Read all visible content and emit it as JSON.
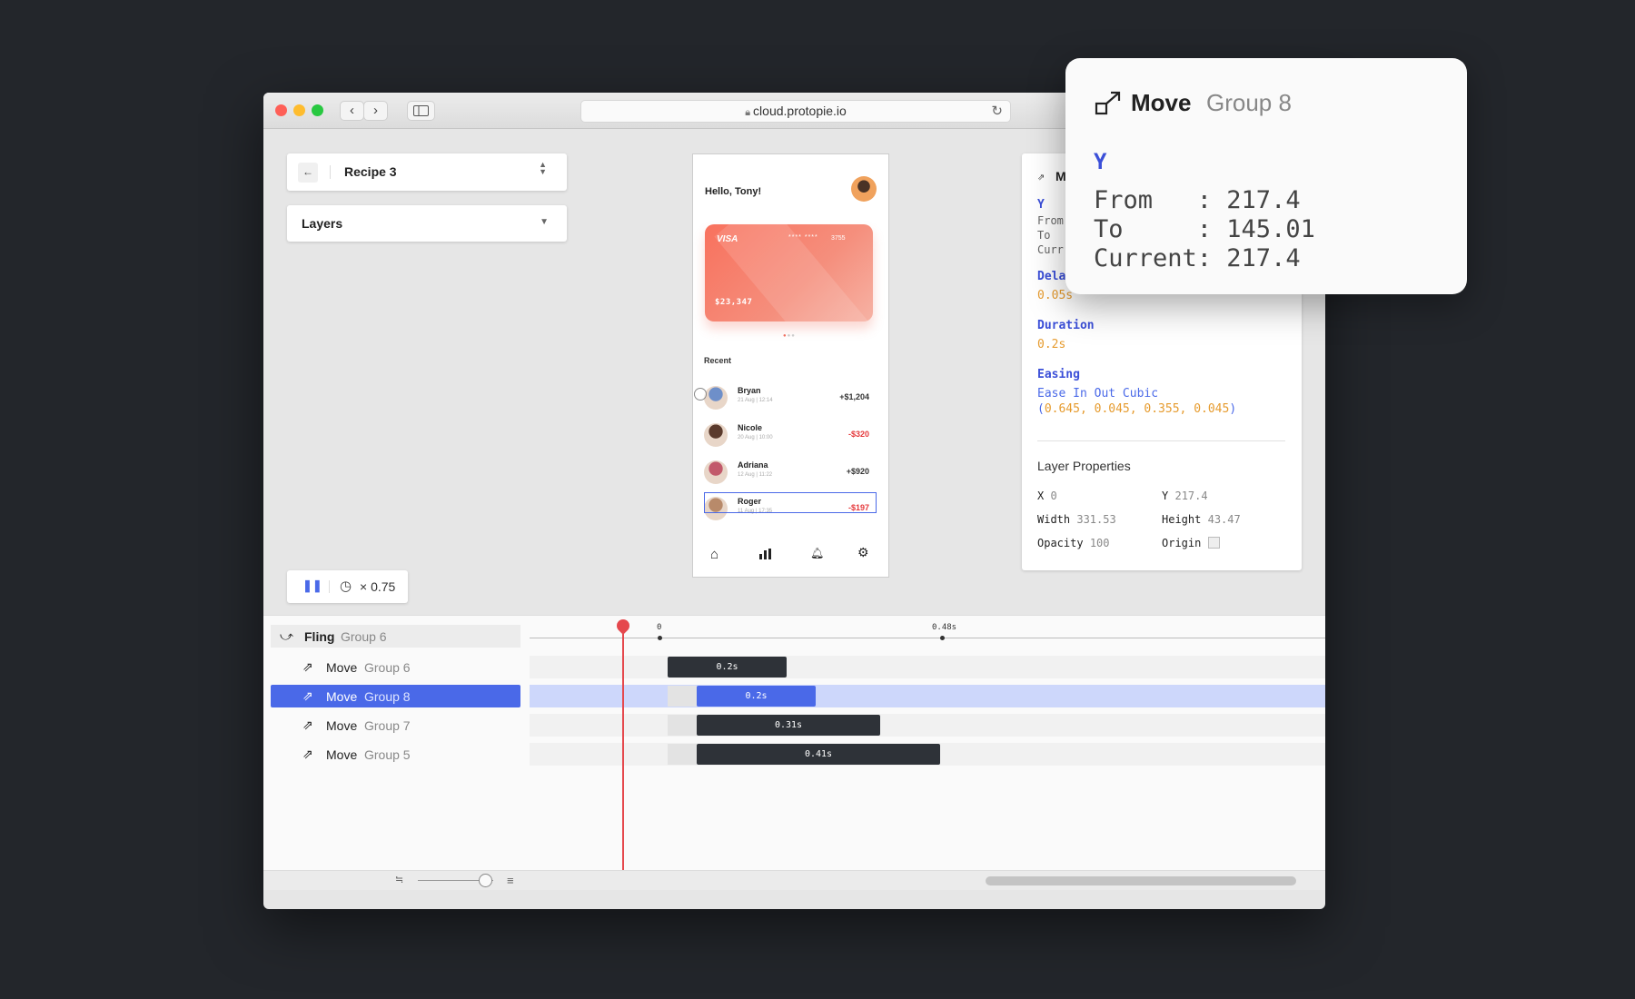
{
  "browser": {
    "url": "cloud.protopie.io"
  },
  "left": {
    "recipe_label": "Recipe 3",
    "layers_label": "Layers",
    "speed_label": "× 0.75"
  },
  "phone": {
    "greeting": "Hello, Tony!",
    "card": {
      "brand": "VISA",
      "mask": "**** ****",
      "last4": "3755",
      "balance": "$23,347"
    },
    "recent_label": "Recent",
    "transactions": [
      {
        "name": "Bryan",
        "date": "21 Aug | 12:14",
        "amount": "+$1,204",
        "color": "#333333"
      },
      {
        "name": "Nicole",
        "date": "20 Aug | 10:00",
        "amount": "-$320",
        "color": "#e5383b"
      },
      {
        "name": "Adriana",
        "date": "12 Aug | 11:22",
        "amount": "+$920",
        "color": "#333333"
      },
      {
        "name": "Roger",
        "date": "11 Aug | 17:35",
        "amount": "-$197",
        "color": "#e5383b"
      }
    ]
  },
  "inspector": {
    "header": "M",
    "y_label": "Y",
    "from_label": "From",
    "to_label": "To",
    "current_label": "Curr",
    "delay_label": "Delay",
    "delay_value": "0.05s",
    "duration_label": "Duration",
    "duration_value": "0.2s",
    "easing_label": "Easing",
    "easing_name": "Ease In Out Cubic",
    "easing_open": "(",
    "easing_values": "0.645, 0.045, 0.355, 0.045",
    "easing_close": ")",
    "layer_props_title": "Layer Properties",
    "props": {
      "x_label": "X",
      "x_value": "0",
      "y_label": "Y",
      "y_value": "217.4",
      "width_label": "Width",
      "width_value": "331.53",
      "height_label": "Height",
      "height_value": "43.47",
      "opacity_label": "Opacity",
      "opacity_value": "100",
      "origin_label": "Origin"
    }
  },
  "timeline": {
    "ruler": {
      "start": "0",
      "mark": "0.48s"
    },
    "rows": [
      {
        "action": "Fling",
        "group": "Group 6"
      },
      {
        "action": "Move",
        "group": "Group 6",
        "duration": "0.2s"
      },
      {
        "action": "Move",
        "group": "Group 8",
        "duration": "0.2s"
      },
      {
        "action": "Move",
        "group": "Group 7",
        "duration": "0.31s"
      },
      {
        "action": "Move",
        "group": "Group 5",
        "duration": "0.41s"
      }
    ]
  },
  "popup": {
    "action": "Move",
    "group": "Group 8",
    "property": "Y",
    "from_line": "From   : 217.4",
    "to_line": "To     : 145.01",
    "current_line": "Current: 217.4"
  },
  "colors": {
    "accent": "#4a69e8",
    "playhead": "#e5484d",
    "label_blue": "#3b4fd8",
    "value_orange": "#e69b2e"
  }
}
